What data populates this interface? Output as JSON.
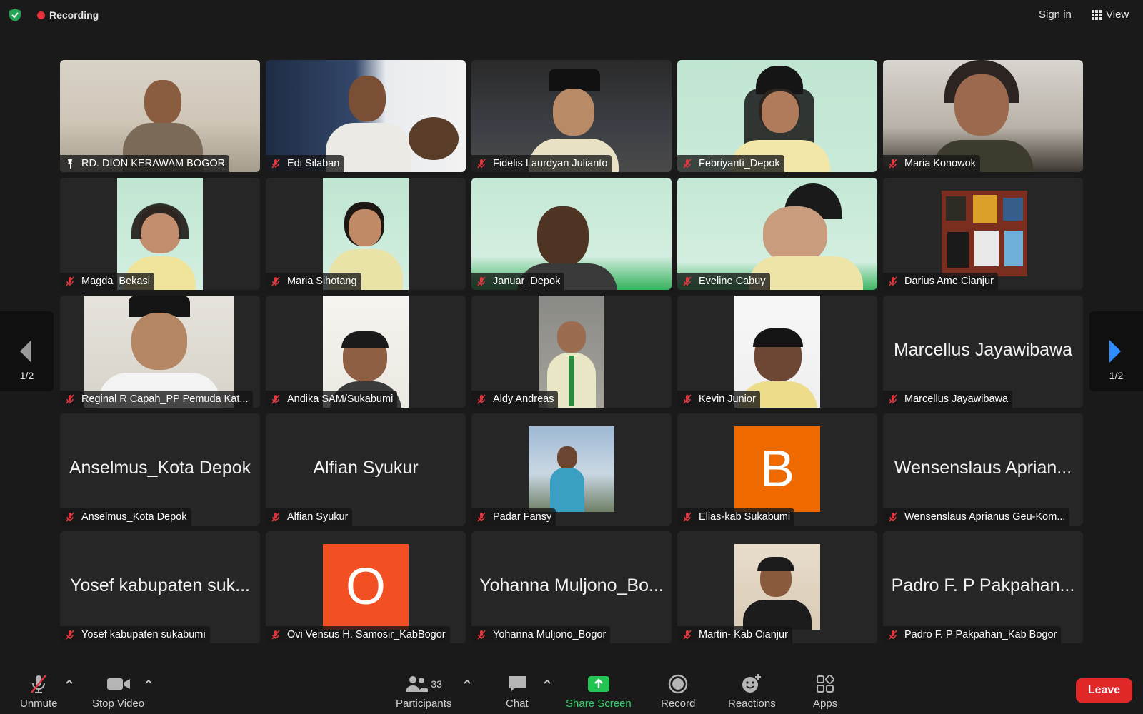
{
  "topbar": {
    "recording": "Recording",
    "sign_in": "Sign in",
    "view": "View"
  },
  "pager": {
    "left": "1/2",
    "right": "1/2"
  },
  "row1": [
    {
      "name": "RD. DION KERAWAM BOGOR"
    },
    {
      "name": "Edi Silaban"
    },
    {
      "name": "Fidelis Laurdyan Julianto"
    },
    {
      "name": "Febriyanti_Depok"
    },
    {
      "name": "Maria Konowok"
    }
  ],
  "row2": [
    {
      "name": "Magda_Bekasi"
    },
    {
      "name": "Maria Sihotang"
    },
    {
      "name": "Januar_Depok"
    },
    {
      "name": "Eveline Cabuy"
    },
    {
      "name": "Darius Ame Cianjur"
    }
  ],
  "row3": [
    {
      "name": "Reginal R Capah_PP Pemuda Kat..."
    },
    {
      "name": "Andika SAM/Sukabumi"
    },
    {
      "name": "Aldy Andreas"
    },
    {
      "name": "Kevin Junior"
    },
    {
      "name": "Marcellus Jayawibawa",
      "display": "Marcellus Jayawibawa"
    }
  ],
  "row4": [
    {
      "name": "Anselmus_Kota Depok",
      "display": "Anselmus_Kota Depok"
    },
    {
      "name": "Alfian Syukur",
      "display": "Alfian Syukur"
    },
    {
      "name": "Padar Fansy"
    },
    {
      "name": "Elias-kab Sukabumi",
      "avatar": "B",
      "avatar_color": "#ee6a00"
    },
    {
      "name": "Wensenslaus Aprianus Geu-Kom...",
      "display": "Wensenslaus Aprian..."
    }
  ],
  "row5": [
    {
      "name": "Yosef kabupaten sukabumi",
      "display": "Yosef kabupaten suk..."
    },
    {
      "name": "Ovi Vensus H. Samosir_KabBogor",
      "avatar": "O",
      "avatar_color": "#f25022"
    },
    {
      "name": "Yohanna Muljono_Bogor",
      "display": "Yohanna Muljono_Bo..."
    },
    {
      "name": "Martin- Kab Cianjur"
    },
    {
      "name": "Padro F. P Pakpahan_Kab Bogor",
      "display": "Padro F. P Pakpahan..."
    }
  ],
  "toolbar": {
    "unmute": "Unmute",
    "stop_video": "Stop Video",
    "participants": "Participants",
    "participant_count": "33",
    "chat": "Chat",
    "share_screen": "Share Screen",
    "record": "Record",
    "reactions": "Reactions",
    "apps": "Apps",
    "leave": "Leave"
  },
  "colors": {
    "active_border": "#3fd45b",
    "share_green": "#33d069",
    "leave_red": "#e02828",
    "recording_red": "#e8303a"
  }
}
